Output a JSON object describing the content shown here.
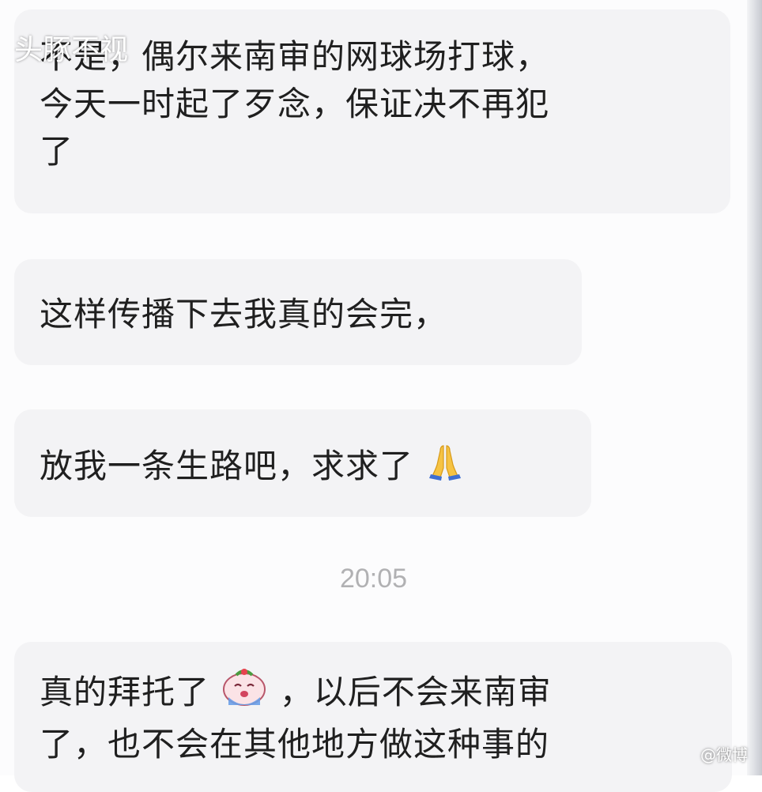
{
  "watermark_text": "头豚不视",
  "messages": [
    {
      "lines": [
        "不是，偶尔来南审的网球场打球，",
        "今天一时起了歹念，保证决不再犯",
        "了"
      ]
    },
    {
      "lines": [
        "这样传播下去我真的会完，"
      ]
    },
    {
      "lines": [
        "放我一条生路吧，求求了"
      ],
      "trailing_emoji": "folded-hands-emoji"
    },
    {
      "lines_parts": [
        [
          "真的拜托了",
          "，以后不会来南审"
        ],
        [
          "了，也不会在其他地方做这种事的"
        ]
      ],
      "inline_emoji": "crying-face-emoji"
    }
  ],
  "timestamp": "20:05",
  "bottom_watermark": "@微博"
}
